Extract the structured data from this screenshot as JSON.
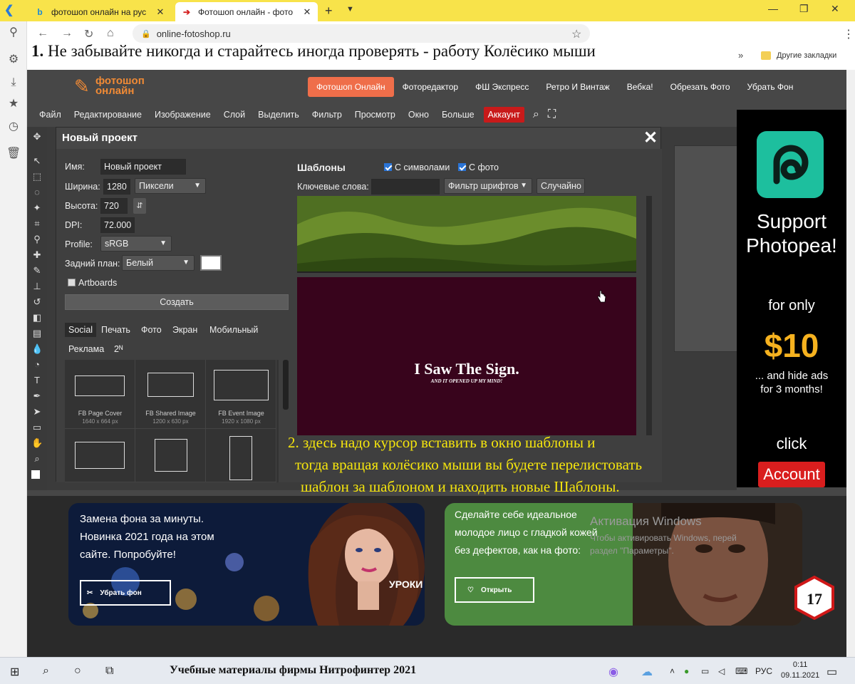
{
  "browser": {
    "tabs": [
      {
        "title": "фотошоп онлайн на рус",
        "favicon": "b"
      },
      {
        "title": "Фотошоп онлайн - фото",
        "favicon": "arrow"
      }
    ],
    "url": "online-fotoshop.ru",
    "bookmarks_label": "Другие закладки",
    "bookmarks_more": "»"
  },
  "annotation_top": {
    "num": "1.",
    "text": " Не забывайте никогда и старайтесь иногда проверять - работу Колёсико мыши"
  },
  "site": {
    "logo_line1": "фотошоп",
    "logo_line2": "онлайн",
    "nav": [
      "Фотошоп Онлайн",
      "Фоторедактор",
      "ФШ Экспресс",
      "Ретро И Винтаж",
      "Вебка!",
      "Обрезать Фото",
      "Убрать Фон"
    ],
    "menu": [
      "Файл",
      "Редактирование",
      "Изображение",
      "Слой",
      "Выделить",
      "Фильтр",
      "Просмотр",
      "Окно",
      "Больше"
    ],
    "account_btn": "Аккаунт"
  },
  "dialog": {
    "title": "Новый проект",
    "close": "✕",
    "name_label": "Имя:",
    "name_value": "Новый проект",
    "width_label": "Ширина:",
    "width_value": "1280",
    "unit_value": "Пиксели",
    "height_label": "Высота:",
    "height_value": "720",
    "swap_icon": "⇵",
    "dpi_label": "DPI:",
    "dpi_value": "72.000",
    "profile_label": "Profile:",
    "profile_value": "sRGB",
    "bg_label": "Задний план:",
    "bg_value": "Белый",
    "artboards_label": "Artboards",
    "create_label": "Создать",
    "categories": [
      "Social",
      "Печать",
      "Фото",
      "Экран",
      "Мобильный",
      "Реклама",
      "2ᴺ"
    ],
    "templates": [
      {
        "name": "FB Page Cover",
        "size": "1640 x 664 px"
      },
      {
        "name": "FB Shared Image",
        "size": "1200 x 630 px"
      },
      {
        "name": "FB Event Image",
        "size": "1920 x 1080 px"
      },
      {
        "name": "",
        "size": ""
      },
      {
        "name": "",
        "size": ""
      },
      {
        "name": "",
        "size": ""
      }
    ],
    "templates_title": "Шаблоны",
    "with_symbols": "С символами",
    "with_photo": "С фото",
    "keywords_label": "Ключевые слова:",
    "font_filter": "Фильтр шрифтов",
    "random": "Случайно",
    "preview_title": "I Saw The Sign.",
    "preview_sub": "AND IT OPENED UP MY MIND!"
  },
  "ad": {
    "line1": "Support",
    "line2": "Photopea!",
    "for_only": "for only",
    "price": "$10",
    "hide1": "... and hide ads",
    "hide2": "for 3 months!",
    "click": "click",
    "account": "Account"
  },
  "annotation_mid": [
    "2. здесь надо курсор вставить в окно шаблоны и",
    "тогда вращая колёсико мыши вы будете перелистовать",
    "шаблон за шаблоном и находить новые Шаблоны."
  ],
  "banner1": {
    "line1": "Замена фона за минуты.",
    "line2": "Новинка 2021 года на этом",
    "line3": "сайте. Попробуйте!",
    "btn": "Убрать фон"
  },
  "banner2": {
    "line1": "Сделайте себе идеальное",
    "line2": "молодое лицо с гладкой кожей",
    "line3": "без дефектов, как на фото:",
    "btn": "Открыть"
  },
  "windows_activation": {
    "title": "Активация Windows",
    "line1": "Чтобы активировать Windows, перей",
    "line2": "раздел \"Параметры\"."
  },
  "lessons": "УРОКИ",
  "badge": "17",
  "taskbar": {
    "caption": "Учебные материалы фирмы Нитрофинтер 2021",
    "lang": "РУС",
    "time": "0:11",
    "date": "09.11.2021"
  },
  "colors": {
    "tab_strip": "#f8e34a",
    "site_bg": "#474747",
    "nav_active": "#ef6e4a",
    "account_red": "#c81a1a",
    "ad_price": "#f6b21f",
    "annotation": "#f5e50d"
  }
}
